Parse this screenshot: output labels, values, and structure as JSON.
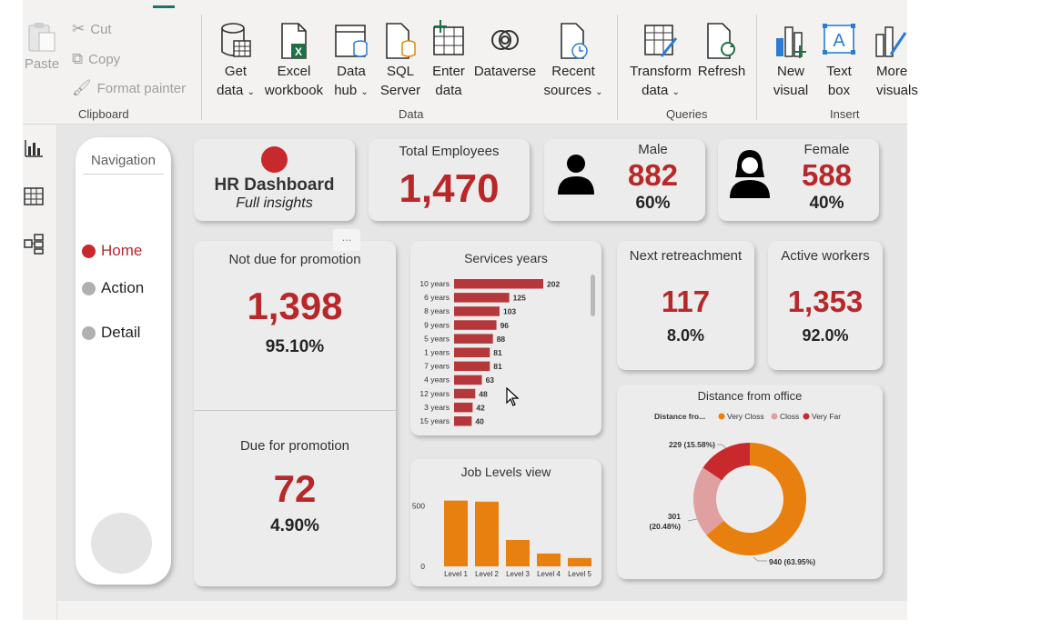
{
  "ribbon": {
    "clipboard": {
      "paste": "Paste",
      "cut": "Cut",
      "copy": "Copy",
      "format_painter": "Format painter",
      "group_label": "Clipboard"
    },
    "data": {
      "get_data_1": "Get",
      "get_data_2": "data",
      "excel_1": "Excel",
      "excel_2": "workbook",
      "data_hub_1": "Data",
      "data_hub_2": "hub",
      "sql_1": "SQL",
      "sql_2": "Server",
      "enter_1": "Enter",
      "enter_2": "data",
      "dataverse": "Dataverse",
      "recent_1": "Recent",
      "recent_2": "sources",
      "group_label": "Data"
    },
    "queries": {
      "transform_1": "Transform",
      "transform_2": "data",
      "refresh": "Refresh",
      "group_label": "Queries"
    },
    "insert": {
      "new_visual_1": "New",
      "new_visual_2": "visual",
      "text_box_1": "Text",
      "text_box_2": "box",
      "more_visuals_1": "More",
      "more_visuals_2": "visuals",
      "group_label": "Insert"
    }
  },
  "navigation": {
    "title": "Navigation",
    "items": [
      {
        "label": "Home",
        "active": true
      },
      {
        "label": "Action",
        "active": false
      },
      {
        "label": "Detail",
        "active": false
      }
    ]
  },
  "header_card": {
    "title": "HR Dashboard",
    "subtitle": "Full insights"
  },
  "kpis": {
    "total_employees": {
      "title": "Total Employees",
      "value": "1,470"
    },
    "male": {
      "title": "Male",
      "value": "882",
      "pct": "60%"
    },
    "female": {
      "title": "Female",
      "value": "588",
      "pct": "40%"
    },
    "not_due": {
      "title": "Not due for promotion",
      "value": "1,398",
      "pct": "95.10%"
    },
    "due": {
      "title": "Due for promotion",
      "value": "72",
      "pct": "4.90%"
    },
    "next_retrenchment": {
      "title": "Next retreachment",
      "value": "117",
      "pct": "8.0%"
    },
    "active_workers": {
      "title": "Active workers",
      "value": "1,353",
      "pct": "92.0%"
    }
  },
  "more_options": "...",
  "colors": {
    "accent_red": "#b8282a",
    "bar_red": "#b5373a",
    "bar_orange": "#e8800f",
    "very_close": "#e8800f",
    "close": "#e0a09f",
    "very_far": "#c8292c"
  },
  "chart_data": [
    {
      "type": "bar",
      "orientation": "horizontal",
      "title": "Services years",
      "categories": [
        "10 years",
        "6 years",
        "8 years",
        "9 years",
        "5 years",
        "1 years",
        "7 years",
        "4 years",
        "12 years",
        "3 years",
        "15 years"
      ],
      "values": [
        202,
        125,
        103,
        96,
        88,
        81,
        81,
        63,
        48,
        42,
        40
      ]
    },
    {
      "type": "bar",
      "title": "Job Levels view",
      "categories": [
        "Level 1",
        "Level 2",
        "Level 3",
        "Level 4",
        "Level 5"
      ],
      "values": [
        543,
        534,
        218,
        106,
        69
      ],
      "yticks": [
        "0",
        "500"
      ],
      "ylim": [
        0,
        600
      ]
    },
    {
      "type": "pie",
      "title": "Distance from office",
      "legend_title": "Distance fro...",
      "legend_position": "top",
      "slices": [
        {
          "name": "Very Closs",
          "value": 940,
          "label": "940 (63.95%)"
        },
        {
          "name": "Closs",
          "value": 301,
          "label_line1": "301",
          "label_line2": "(20.48%)"
        },
        {
          "name": "Very Far",
          "value": 229,
          "label": "229 (15.58%)"
        }
      ]
    }
  ]
}
